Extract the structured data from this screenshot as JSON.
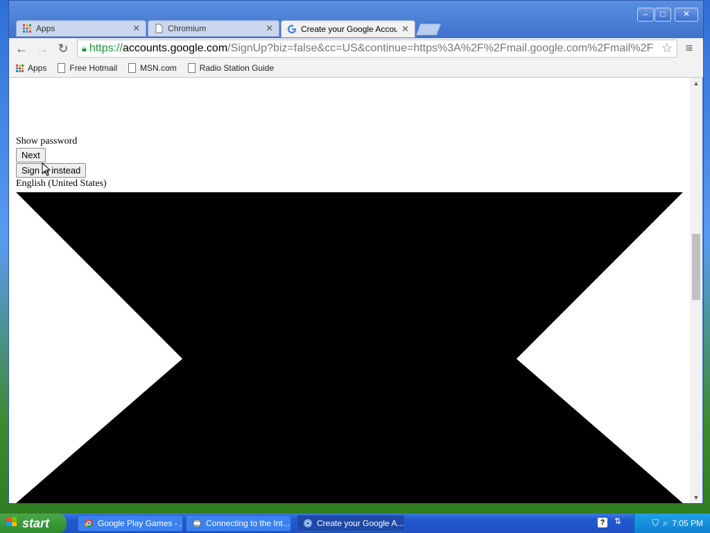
{
  "browser": {
    "tabs": [
      {
        "label": "Apps",
        "icon": "apps-grid-icon"
      },
      {
        "label": "Chromium",
        "icon": "page-icon"
      },
      {
        "label": "Create your Google Account",
        "icon": "google-g-icon"
      }
    ],
    "window_controls": {
      "minimize": "–",
      "maximize": "□",
      "close": "✕"
    },
    "url": {
      "scheme": "https://",
      "host": "accounts.google.com",
      "path": "/SignUp?biz=false&cc=US&continue=https%3A%2F%2Fmail.google.com%2Fmail%2F"
    },
    "bookmarks": [
      {
        "label": "Apps",
        "icon": "apps-grid-icon"
      },
      {
        "label": "Free Hotmail",
        "icon": "page-icon"
      },
      {
        "label": "MSN.com",
        "icon": "page-icon"
      },
      {
        "label": "Radio Station Guide",
        "icon": "page-icon"
      }
    ]
  },
  "page": {
    "show_password": "Show password",
    "next_button": "Next",
    "sign_in_button": "Sign in instead",
    "language": "English (United States)"
  },
  "taskbar": {
    "start_label": "start",
    "tasks": [
      {
        "label": "Google Play Games - ...",
        "icon": "chrome-icon"
      },
      {
        "label": "Connecting to the Int...",
        "icon": "connection-wizard-icon"
      },
      {
        "label": "Create your Google A...",
        "icon": "chromium-icon"
      }
    ],
    "clock": "7:05 PM"
  },
  "colors": {
    "xp_blue": "#235ad0",
    "start_green": "#2e8b2e",
    "secure_green": "#1a9a3c"
  }
}
